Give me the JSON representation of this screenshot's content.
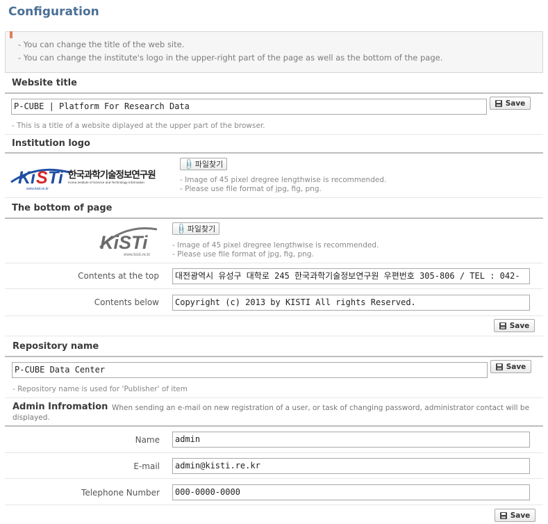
{
  "page": {
    "title": "Configuration"
  },
  "notice": {
    "lines": [
      "- You can change the title of the web site.",
      "- You can change the institute's logo in the upper-right part of the page as well as the bottom of the page."
    ]
  },
  "website_title": {
    "heading": "Website title",
    "value": "P-CUBE | Platform For Research Data",
    "hint": "- This is a title of a website diplayed at the upper part of the browser.",
    "save_label": "Save"
  },
  "institution_logo": {
    "heading": "Institution logo",
    "logo_brand": "KISTI",
    "logo_korean": "한국과학기술정보연구원",
    "logo_english": "Korea Institute of Science and Technology Information",
    "logo_url": "www.kisti.re.kr",
    "file_button": "파일찾기",
    "hint1": "- Image of 45 pixel dregree lengthwise is recommended.",
    "hint2": "- Please use file format of jpg, fig, png."
  },
  "bottom_of_page": {
    "heading": "The bottom of page",
    "logo_brand": "KISTI",
    "logo_url": "www.kisti.re.kr",
    "file_button": "파일찾기",
    "hint1": "- Image of 45 pixel dregree lengthwise is recommended.",
    "hint2": "- Please use file format of jpg, fig, png.",
    "top_label": "Contents at the top",
    "top_value": "대전광역시 유성구 대학로 245 한국과학기술정보연구원 우편번호 305-806 / TEL : 042-",
    "below_label": "Contents below",
    "below_value": "Copyright (c) 2013 by KISTI All rights Reserved.",
    "save_label": "Save"
  },
  "repository": {
    "heading": "Repository name",
    "value": "P-CUBE Data Center",
    "hint": "- Repository name is used for 'Publisher' of item",
    "save_label": "Save"
  },
  "admin": {
    "heading": "Admin Infromation",
    "description_line1": "When sending an e-mail on new registration of a user, or task of changing password, administrator contact will be",
    "description_line2": "displayed.",
    "name_label": "Name",
    "name_value": "admin",
    "email_label": "E-mail",
    "email_value": "admin@kisti.re.kr",
    "phone_label": "Telephone Number",
    "phone_value": "000-0000-0000",
    "save_label": "Save"
  },
  "colors": {
    "title": "#4a6f95",
    "kisti_blue": "#1f4fa3",
    "kisti_red": "#d9262b",
    "notice_flag": "#e57b5e"
  }
}
